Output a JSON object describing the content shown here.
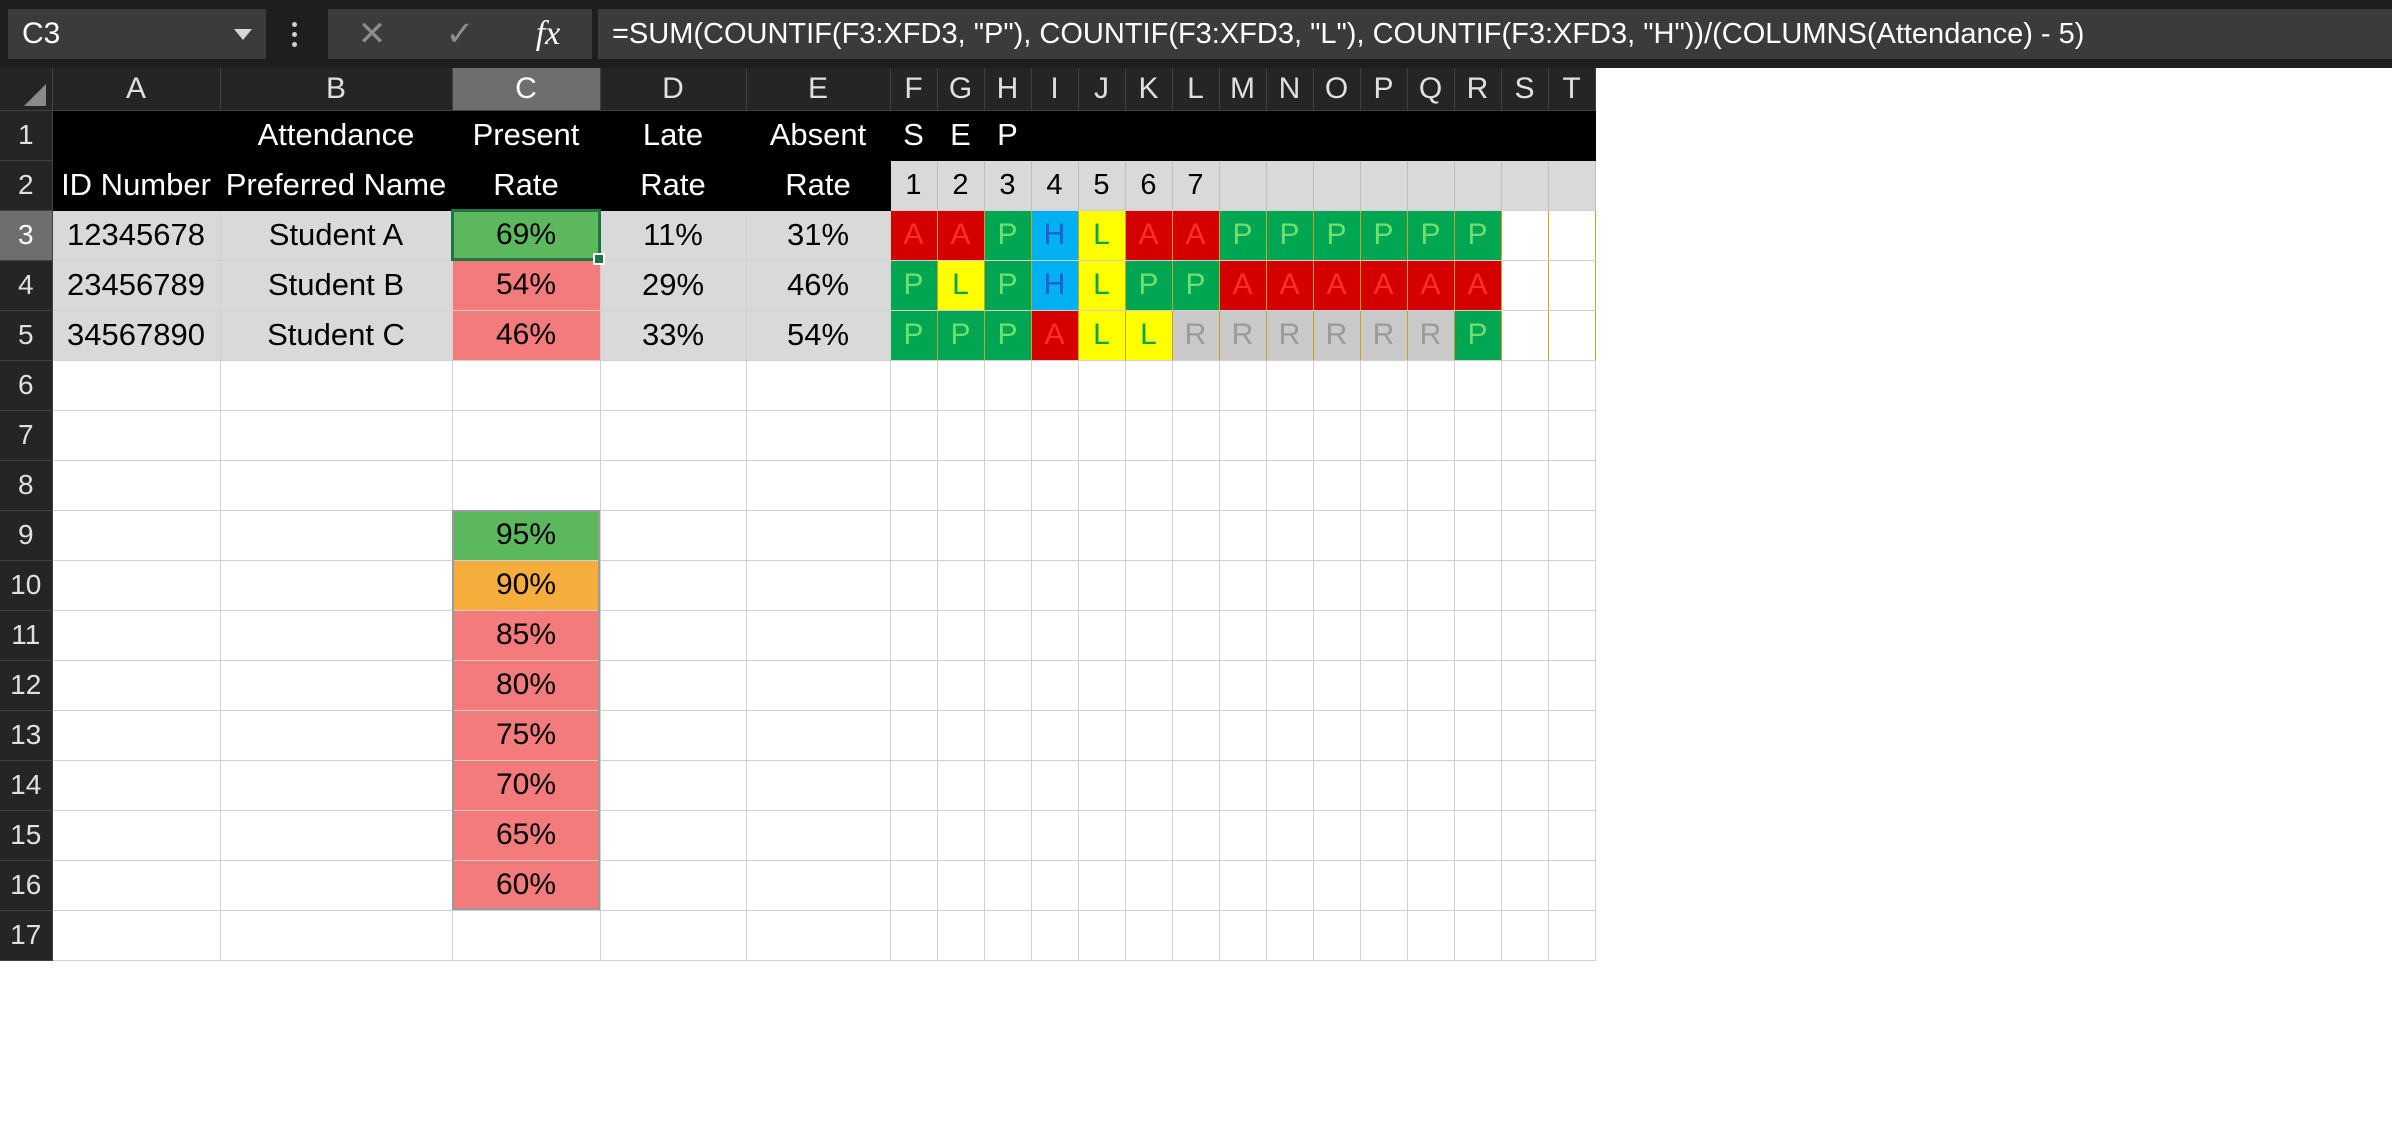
{
  "app": {
    "name_box_value": "C3",
    "formula": "=SUM(COUNTIF(F3:XFD3, \"P\"), COUNTIF(F3:XFD3, \"L\"), COUNTIF(F3:XFD3, \"H\"))/(COLUMNS(Attendance) - 5)",
    "cancel_icon": "✕",
    "confirm_icon": "✓",
    "fx_label": "fx",
    "dropdown_caret": "caret-down"
  },
  "colors": {
    "present_green": "#00a651",
    "absent_red": "#d40000",
    "late_yellow": "#ffff00",
    "holiday_cyan": "#00b0f0",
    "na_gray": "#c9c9c9",
    "fill_good": "#5cb85c",
    "fill_warn": "#f5ae3c",
    "fill_bad": "#f47b7b",
    "selection": "#217346",
    "header_black": "#000000",
    "data_gray": "#d9d9d9"
  },
  "columns": [
    "A",
    "B",
    "C",
    "D",
    "E",
    "F",
    "G",
    "H",
    "I",
    "J",
    "K",
    "L",
    "M",
    "N",
    "O",
    "P",
    "Q",
    "R",
    "S",
    "T"
  ],
  "selected_column": "C",
  "rows": [
    "1",
    "2",
    "3",
    "4",
    "5",
    "6",
    "7",
    "8",
    "9",
    "10",
    "11",
    "12",
    "13",
    "14",
    "15",
    "16",
    "17"
  ],
  "selected_row": "3",
  "sheet": {
    "row1": {
      "A": "",
      "B": "Attendance",
      "C": "Present",
      "D": "Late",
      "E": "Absent",
      "F": "S",
      "G": "E",
      "H": "P"
    },
    "row2": {
      "A": "ID Number",
      "B": "Preferred Name",
      "C": "Rate",
      "D": "Rate",
      "E": "Rate",
      "days": [
        "1",
        "2",
        "3",
        "4",
        "5",
        "6",
        "7"
      ]
    },
    "students": [
      {
        "row": "3",
        "id": "12345678",
        "name": "Student A",
        "present_rate": "69%",
        "present_fill": "green",
        "late_rate": "11%",
        "absent_rate": "31%",
        "attendance": [
          "A",
          "A",
          "P",
          "H",
          "L",
          "A",
          "A",
          "P",
          "P",
          "P",
          "P",
          "P",
          "P"
        ]
      },
      {
        "row": "4",
        "id": "23456789",
        "name": "Student B",
        "present_rate": "54%",
        "present_fill": "red",
        "late_rate": "29%",
        "absent_rate": "46%",
        "attendance": [
          "P",
          "L",
          "P",
          "H",
          "L",
          "P",
          "P",
          "A",
          "A",
          "A",
          "A",
          "A",
          "A"
        ]
      },
      {
        "row": "5",
        "id": "34567890",
        "name": "Student C",
        "present_rate": "46%",
        "present_fill": "red",
        "late_rate": "33%",
        "absent_rate": "54%",
        "attendance": [
          "P",
          "P",
          "P",
          "A",
          "L",
          "L",
          "R",
          "R",
          "R",
          "R",
          "R",
          "R",
          "P"
        ]
      }
    ],
    "legend": [
      {
        "row": "9",
        "value": "95%",
        "fill": "green"
      },
      {
        "row": "10",
        "value": "90%",
        "fill": "orange"
      },
      {
        "row": "11",
        "value": "85%",
        "fill": "red"
      },
      {
        "row": "12",
        "value": "80%",
        "fill": "red"
      },
      {
        "row": "13",
        "value": "75%",
        "fill": "red"
      },
      {
        "row": "14",
        "value": "70%",
        "fill": "red"
      },
      {
        "row": "15",
        "value": "65%",
        "fill": "red"
      },
      {
        "row": "16",
        "value": "60%",
        "fill": "red"
      }
    ]
  }
}
